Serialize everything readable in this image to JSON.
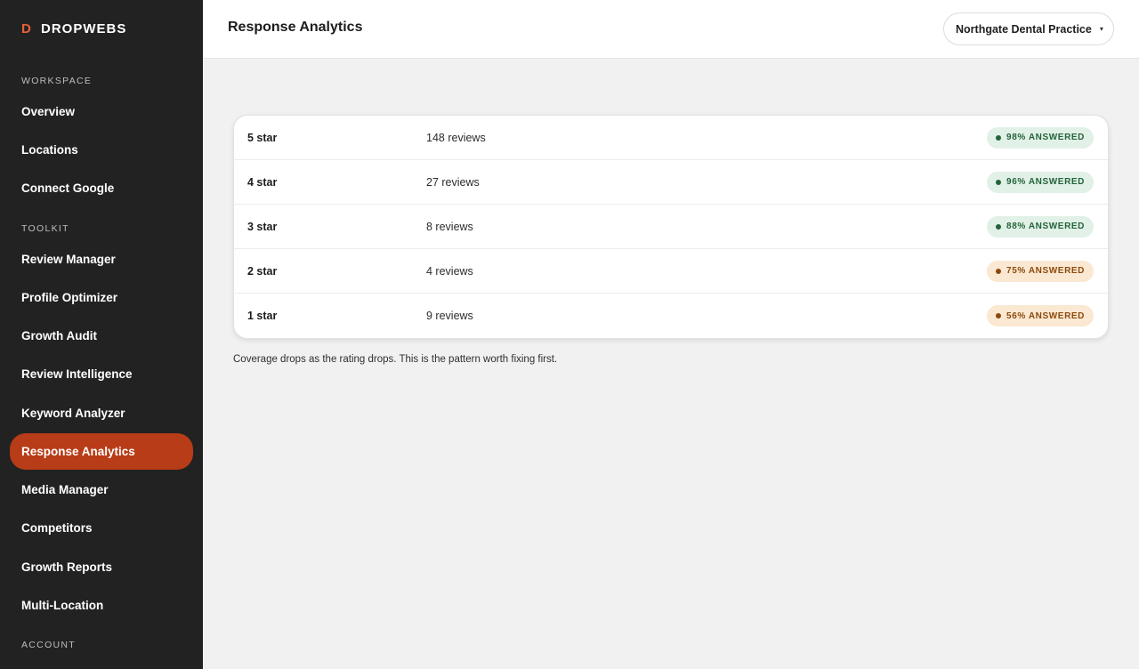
{
  "brand": {
    "mark": "D",
    "name": "DROPWEBS"
  },
  "sidebar": {
    "sections": [
      {
        "label": "WORKSPACE",
        "items": [
          {
            "label": "Overview"
          },
          {
            "label": "Locations"
          },
          {
            "label": "Connect Google"
          }
        ]
      },
      {
        "label": "TOOLKIT",
        "items": [
          {
            "label": "Review Manager"
          },
          {
            "label": "Profile Optimizer"
          },
          {
            "label": "Growth Audit"
          },
          {
            "label": "Review Intelligence"
          },
          {
            "label": "Keyword Analyzer"
          },
          {
            "label": "Response Analytics",
            "active": true
          },
          {
            "label": "Media Manager"
          },
          {
            "label": "Competitors"
          },
          {
            "label": "Growth Reports"
          },
          {
            "label": "Multi-Location"
          }
        ]
      },
      {
        "label": "ACCOUNT",
        "items": []
      }
    ]
  },
  "header": {
    "title": "Response Analytics",
    "location": {
      "value": "Northgate Dental Practice",
      "caret": "▾"
    }
  },
  "ratings_table": {
    "rows": [
      {
        "rating": "5 star",
        "count": "148 reviews",
        "badge": "98% ANSWERED",
        "status": "good"
      },
      {
        "rating": "4 star",
        "count": "27 reviews",
        "badge": "96% ANSWERED",
        "status": "good"
      },
      {
        "rating": "3 star",
        "count": "8 reviews",
        "badge": "88% ANSWERED",
        "status": "good"
      },
      {
        "rating": "2 star",
        "count": "4 reviews",
        "badge": "75% ANSWERED",
        "status": "warn"
      },
      {
        "rating": "1 star",
        "count": "9 reviews",
        "badge": "56% ANSWERED",
        "status": "warn"
      }
    ]
  },
  "footnote": "Coverage drops as the rating drops. This is the pattern worth fixing first.",
  "colors": {
    "accent": "#b83c17",
    "brand_mark": "#e8613a",
    "sidebar_bg": "#222222",
    "good_bg": "#e2f1e7",
    "good_fg": "#23633a",
    "warn_bg": "#fbe8d2",
    "warn_fg": "#8a4a0c"
  }
}
